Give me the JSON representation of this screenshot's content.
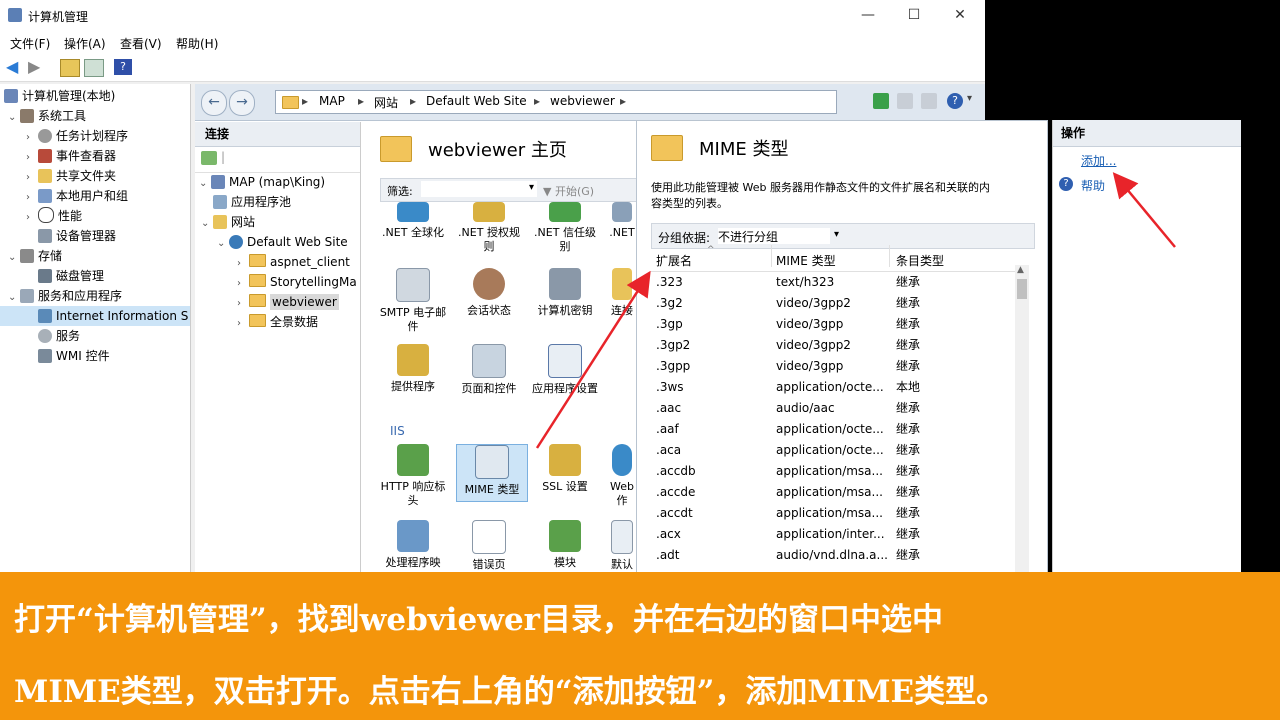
{
  "window": {
    "title": "计算机管理",
    "min": "—",
    "max": "☐",
    "close": "✕"
  },
  "menu": [
    "文件(F)",
    "操作(A)",
    "查看(V)",
    "帮助(H)"
  ],
  "tree": {
    "root": "计算机管理(本地)",
    "system_tools": "系统工具",
    "task_scheduler": "任务计划程序",
    "event_viewer": "事件查看器",
    "shared_folders": "共享文件夹",
    "local_users": "本地用户和组",
    "performance": "性能",
    "device_manager": "设备管理器",
    "storage": "存储",
    "disk_mgmt": "磁盘管理",
    "services_apps": "服务和应用程序",
    "iis": "Internet Information S",
    "services": "服务",
    "wmi": "WMI 控件"
  },
  "address": {
    "items": [
      "MAP",
      "网站",
      "Default Web Site",
      "webviewer"
    ]
  },
  "connections": {
    "header": "连接",
    "server": "MAP (map\\King)",
    "app_pools": "应用程序池",
    "sites": "网站",
    "default_site": "Default Web Site",
    "aspnet": "aspnet_client",
    "storytelling": "StorytellingMa",
    "webviewer": "webviewer",
    "panorama": "全景数据"
  },
  "features": {
    "title": "webviewer 主页",
    "filter_label": "筛选:",
    "start": "开始(G)",
    "row1": [
      ".NET 全球化",
      ".NET 授权规则",
      ".NET 信任级别",
      ".NET"
    ],
    "row2": [
      "SMTP 电子邮件",
      "会话状态",
      "计算机密钥",
      "连接"
    ],
    "row3": [
      "提供程序",
      "页面和控件",
      "应用程序设置"
    ],
    "iis_group": "IIS",
    "row4": [
      "HTTP 响应标头",
      "MIME 类型",
      "SSL 设置",
      "Web作"
    ],
    "row5": [
      "处理程序映",
      "错误页",
      "模块",
      "默认"
    ]
  },
  "mime": {
    "title": "MIME 类型",
    "desc1": "使用此功能管理被 Web 服务器用作静态文件的文件扩展名和关联的内",
    "desc2": "容类型的列表。",
    "group_label": "分组依据:",
    "group_value": "不进行分组",
    "col_ext": "扩展名",
    "col_type": "MIME 类型",
    "col_entry": "条目类型",
    "rows": [
      [
        ".323",
        "text/h323",
        "继承"
      ],
      [
        ".3g2",
        "video/3gpp2",
        "继承"
      ],
      [
        ".3gp",
        "video/3gpp",
        "继承"
      ],
      [
        ".3gp2",
        "video/3gpp2",
        "继承"
      ],
      [
        ".3gpp",
        "video/3gpp",
        "继承"
      ],
      [
        ".3ws",
        "application/octe...",
        "本地"
      ],
      [
        ".aac",
        "audio/aac",
        "继承"
      ],
      [
        ".aaf",
        "application/octe...",
        "继承"
      ],
      [
        ".aca",
        "application/octe...",
        "继承"
      ],
      [
        ".accdb",
        "application/msa...",
        "继承"
      ],
      [
        ".accde",
        "application/msa...",
        "继承"
      ],
      [
        ".accdt",
        "application/msa...",
        "继承"
      ],
      [
        ".acx",
        "application/inter...",
        "继承"
      ],
      [
        ".adt",
        "audio/vnd.dlna.a...",
        "继承"
      ]
    ]
  },
  "actions": {
    "header": "操作",
    "add": "添加...",
    "help": "帮助"
  },
  "caption": {
    "line1": "打开“计算机管理”，找到webviewer目录，并在右边的窗口中选中",
    "line2": "MIME类型，双击打开。点击右上角的“添加按钮”，添加MIME类型。"
  },
  "colors": {
    "caption_bg": "#f4950b",
    "arrow": "#e8242a",
    "link": "#1a5fb4"
  }
}
